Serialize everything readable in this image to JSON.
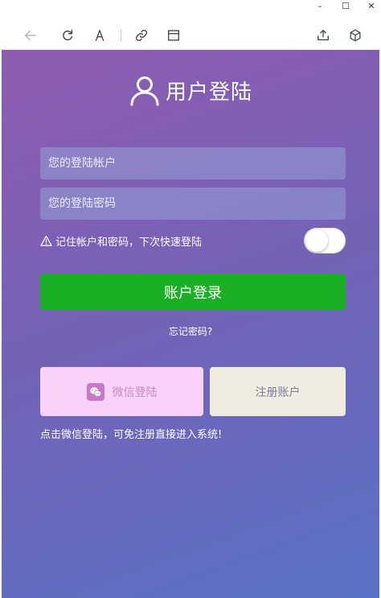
{
  "window": {
    "minimize": "–",
    "maximize": "☐",
    "close": "✕"
  },
  "toolbar": {
    "icons": [
      "back-arrow-icon",
      "refresh-icon",
      "text-icon",
      "link-icon",
      "window-icon",
      "share-icon",
      "cube-icon"
    ]
  },
  "header": {
    "title": "用户登陆"
  },
  "form": {
    "account_placeholder": "您的登陆帐户",
    "password_placeholder": "您的登陆密码",
    "remember_label": "记住帐户和密码，下次快速登陆",
    "remember_enabled": false,
    "login_button": "账户登录",
    "forgot_link": "忘记密码?"
  },
  "actions": {
    "wechat_button": "微信登陆",
    "register_button": "注册账户",
    "tip": "点击微信登陆，可免注册直接进入系统!"
  },
  "colors": {
    "gradient_start": "#8f5cb2",
    "gradient_end": "#5a72c5",
    "login_green": "#1aaf25",
    "wechat_bg": "#f8d2f8",
    "register_bg": "#f1ece0"
  }
}
